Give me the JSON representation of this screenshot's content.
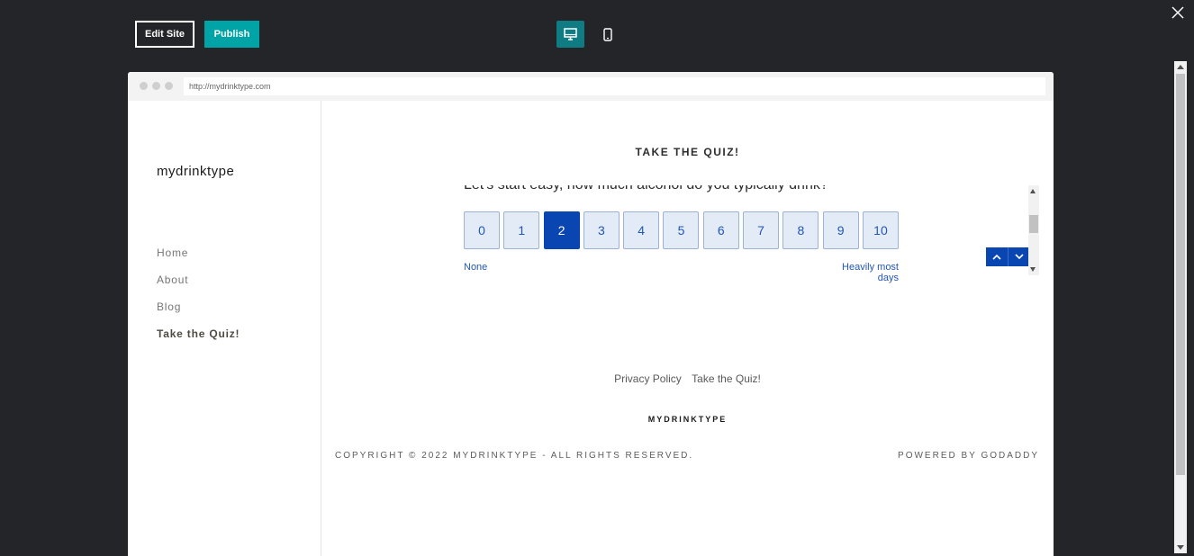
{
  "toolbar": {
    "edit_label": "Edit Site",
    "publish_label": "Publish",
    "colors": {
      "publish": "#00a4a6",
      "desktop_active": "#0f7b82"
    }
  },
  "browser": {
    "url": "http://mydrinktype.com"
  },
  "sidebar": {
    "logo": "mydrinktype",
    "items": [
      {
        "label": "Home"
      },
      {
        "label": "About"
      },
      {
        "label": "Blog"
      },
      {
        "label": "Take the Quiz!",
        "active": true
      }
    ]
  },
  "main": {
    "title": "TAKE THE QUIZ!",
    "question": "Let's start easy, how much alcohol do you typically drink?",
    "scale": {
      "options": [
        "0",
        "1",
        "2",
        "3",
        "4",
        "5",
        "6",
        "7",
        "8",
        "9",
        "10"
      ],
      "selected": "2",
      "min_label": "None",
      "max_label": "Heavily most days"
    }
  },
  "footer": {
    "links": [
      "Privacy Policy",
      "Take the Quiz!"
    ],
    "brand": "MYDRINKTYPE",
    "copyright": "COPYRIGHT © 2022 MYDRINKTYPE - ALL RIGHTS RESERVED.",
    "powered_prefix": "POWERED BY ",
    "powered_link": "GODADDY"
  },
  "icons": {
    "desktop": "desktop-icon",
    "mobile": "mobile-icon",
    "close": "close-icon",
    "up": "chevron-up-icon",
    "down": "chevron-down-icon"
  }
}
